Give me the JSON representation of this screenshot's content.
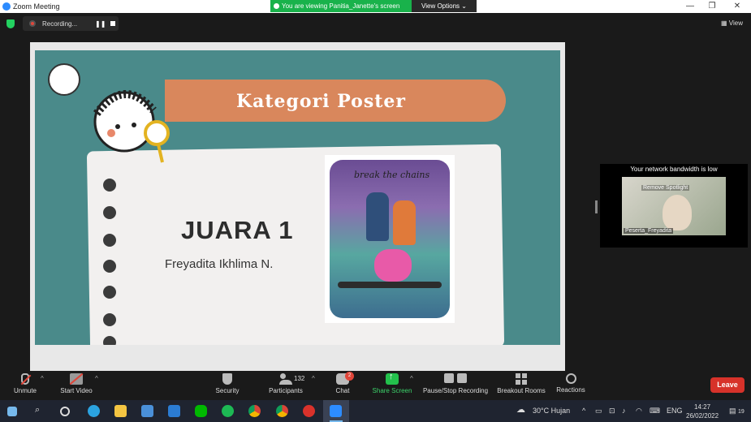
{
  "window": {
    "title": "Zoom Meeting",
    "controls": [
      "—",
      "❐",
      "✕"
    ]
  },
  "banner": {
    "viewing_text": "You are viewing Panitia_Janette's screen",
    "view_options": "View Options ⌄"
  },
  "recording": {
    "label": "Recording...",
    "pause": "❚❚"
  },
  "view_button": "View",
  "slide": {
    "title": "Kategori Poster",
    "heading": "JUARA 1",
    "winner_name": "Freyadita Ikhlima N.",
    "poster_title": "break the chains"
  },
  "thumbnail": {
    "bandwidth_warning": "Your network bandwidth is low",
    "spotlight_label": "Remove Spotlight",
    "participant_name": "Peserta_Freyadita"
  },
  "controls": {
    "unmute": "Unmute",
    "start_video": "Start Video",
    "security": "Security",
    "participants": "Participants",
    "participant_count": "132",
    "chat": "Chat",
    "chat_badge": "2",
    "share_screen": "Share Screen",
    "pause_stop_recording": "Pause/Stop Recording",
    "breakout_rooms": "Breakout Rooms",
    "reactions": "Reactions",
    "leave": "Leave"
  },
  "taskbar": {
    "weather": "30°C  Hujan",
    "language": "ENG",
    "time": "14:27",
    "date": "26/02/2022",
    "notifications": "19"
  },
  "colors": {
    "slide_bg": "#4a8a8a",
    "title_band": "#d9875c",
    "banner_green": "#19b24b",
    "leave_red": "#d7322a",
    "share_green": "#23c14c"
  }
}
